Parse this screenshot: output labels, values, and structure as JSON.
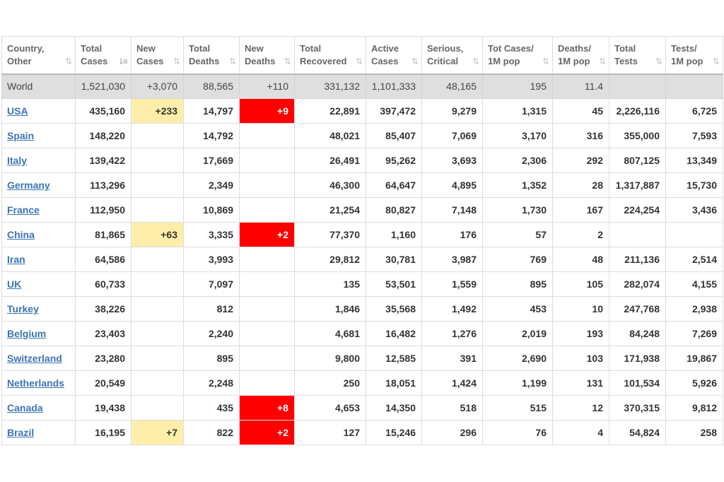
{
  "columns": [
    {
      "l1": "Country,",
      "l2": "Other",
      "sort": "asc-desc"
    },
    {
      "l1": "Total",
      "l2": "Cases",
      "sort": "active"
    },
    {
      "l1": "New",
      "l2": "Cases",
      "sort": "asc-desc"
    },
    {
      "l1": "Total",
      "l2": "Deaths",
      "sort": "asc-desc"
    },
    {
      "l1": "New",
      "l2": "Deaths",
      "sort": "asc-desc"
    },
    {
      "l1": "Total",
      "l2": "Recovered",
      "sort": "asc-desc"
    },
    {
      "l1": "Active",
      "l2": "Cases",
      "sort": "asc-desc"
    },
    {
      "l1": "Serious,",
      "l2": "Critical",
      "sort": "asc-desc"
    },
    {
      "l1": "Tot Cases/",
      "l2": "1M pop",
      "sort": "asc-desc"
    },
    {
      "l1": "Deaths/",
      "l2": "1M pop",
      "sort": "asc-desc"
    },
    {
      "l1": "Total",
      "l2": "Tests",
      "sort": "asc-desc"
    },
    {
      "l1": "Tests/",
      "l2": "1M pop",
      "sort": "asc-desc"
    }
  ],
  "sort_icon": "⇅",
  "sort_icon_active": "⇂≡",
  "colors": {
    "link": "#3b74b6",
    "new_cases_highlight": "#ffeeaa",
    "new_deaths_highlight": "#ff0000",
    "world_row_bg": "#dfdfdf"
  },
  "world": {
    "country": "World",
    "total_cases": "1,521,030",
    "new_cases": "+3,070",
    "total_deaths": "88,565",
    "new_deaths": "+110",
    "total_recovered": "331,132",
    "active_cases": "1,101,333",
    "serious_critical": "48,165",
    "cases_per_1m": "195",
    "deaths_per_1m": "11.4",
    "total_tests": "",
    "tests_per_1m": ""
  },
  "rows": [
    {
      "country": "USA",
      "total_cases": "435,160",
      "new_cases": "+233",
      "total_deaths": "14,797",
      "new_deaths": "+9",
      "total_recovered": "22,891",
      "active_cases": "397,472",
      "serious_critical": "9,279",
      "cases_per_1m": "1,315",
      "deaths_per_1m": "45",
      "total_tests": "2,226,116",
      "tests_per_1m": "6,725"
    },
    {
      "country": "Spain",
      "total_cases": "148,220",
      "new_cases": "",
      "total_deaths": "14,792",
      "new_deaths": "",
      "total_recovered": "48,021",
      "active_cases": "85,407",
      "serious_critical": "7,069",
      "cases_per_1m": "3,170",
      "deaths_per_1m": "316",
      "total_tests": "355,000",
      "tests_per_1m": "7,593"
    },
    {
      "country": "Italy",
      "total_cases": "139,422",
      "new_cases": "",
      "total_deaths": "17,669",
      "new_deaths": "",
      "total_recovered": "26,491",
      "active_cases": "95,262",
      "serious_critical": "3,693",
      "cases_per_1m": "2,306",
      "deaths_per_1m": "292",
      "total_tests": "807,125",
      "tests_per_1m": "13,349"
    },
    {
      "country": "Germany",
      "total_cases": "113,296",
      "new_cases": "",
      "total_deaths": "2,349",
      "new_deaths": "",
      "total_recovered": "46,300",
      "active_cases": "64,647",
      "serious_critical": "4,895",
      "cases_per_1m": "1,352",
      "deaths_per_1m": "28",
      "total_tests": "1,317,887",
      "tests_per_1m": "15,730"
    },
    {
      "country": "France",
      "total_cases": "112,950",
      "new_cases": "",
      "total_deaths": "10,869",
      "new_deaths": "",
      "total_recovered": "21,254",
      "active_cases": "80,827",
      "serious_critical": "7,148",
      "cases_per_1m": "1,730",
      "deaths_per_1m": "167",
      "total_tests": "224,254",
      "tests_per_1m": "3,436"
    },
    {
      "country": "China",
      "total_cases": "81,865",
      "new_cases": "+63",
      "total_deaths": "3,335",
      "new_deaths": "+2",
      "total_recovered": "77,370",
      "active_cases": "1,160",
      "serious_critical": "176",
      "cases_per_1m": "57",
      "deaths_per_1m": "2",
      "total_tests": "",
      "tests_per_1m": ""
    },
    {
      "country": "Iran",
      "total_cases": "64,586",
      "new_cases": "",
      "total_deaths": "3,993",
      "new_deaths": "",
      "total_recovered": "29,812",
      "active_cases": "30,781",
      "serious_critical": "3,987",
      "cases_per_1m": "769",
      "deaths_per_1m": "48",
      "total_tests": "211,136",
      "tests_per_1m": "2,514"
    },
    {
      "country": "UK",
      "total_cases": "60,733",
      "new_cases": "",
      "total_deaths": "7,097",
      "new_deaths": "",
      "total_recovered": "135",
      "active_cases": "53,501",
      "serious_critical": "1,559",
      "cases_per_1m": "895",
      "deaths_per_1m": "105",
      "total_tests": "282,074",
      "tests_per_1m": "4,155"
    },
    {
      "country": "Turkey",
      "total_cases": "38,226",
      "new_cases": "",
      "total_deaths": "812",
      "new_deaths": "",
      "total_recovered": "1,846",
      "active_cases": "35,568",
      "serious_critical": "1,492",
      "cases_per_1m": "453",
      "deaths_per_1m": "10",
      "total_tests": "247,768",
      "tests_per_1m": "2,938"
    },
    {
      "country": "Belgium",
      "total_cases": "23,403",
      "new_cases": "",
      "total_deaths": "2,240",
      "new_deaths": "",
      "total_recovered": "4,681",
      "active_cases": "16,482",
      "serious_critical": "1,276",
      "cases_per_1m": "2,019",
      "deaths_per_1m": "193",
      "total_tests": "84,248",
      "tests_per_1m": "7,269"
    },
    {
      "country": "Switzerland",
      "total_cases": "23,280",
      "new_cases": "",
      "total_deaths": "895",
      "new_deaths": "",
      "total_recovered": "9,800",
      "active_cases": "12,585",
      "serious_critical": "391",
      "cases_per_1m": "2,690",
      "deaths_per_1m": "103",
      "total_tests": "171,938",
      "tests_per_1m": "19,867"
    },
    {
      "country": "Netherlands",
      "total_cases": "20,549",
      "new_cases": "",
      "total_deaths": "2,248",
      "new_deaths": "",
      "total_recovered": "250",
      "active_cases": "18,051",
      "serious_critical": "1,424",
      "cases_per_1m": "1,199",
      "deaths_per_1m": "131",
      "total_tests": "101,534",
      "tests_per_1m": "5,926"
    },
    {
      "country": "Canada",
      "total_cases": "19,438",
      "new_cases": "",
      "total_deaths": "435",
      "new_deaths": "+8",
      "total_recovered": "4,653",
      "active_cases": "14,350",
      "serious_critical": "518",
      "cases_per_1m": "515",
      "deaths_per_1m": "12",
      "total_tests": "370,315",
      "tests_per_1m": "9,812"
    },
    {
      "country": "Brazil",
      "total_cases": "16,195",
      "new_cases": "+7",
      "total_deaths": "822",
      "new_deaths": "+2",
      "total_recovered": "127",
      "active_cases": "15,246",
      "serious_critical": "296",
      "cases_per_1m": "76",
      "deaths_per_1m": "4",
      "total_tests": "54,824",
      "tests_per_1m": "258"
    }
  ]
}
